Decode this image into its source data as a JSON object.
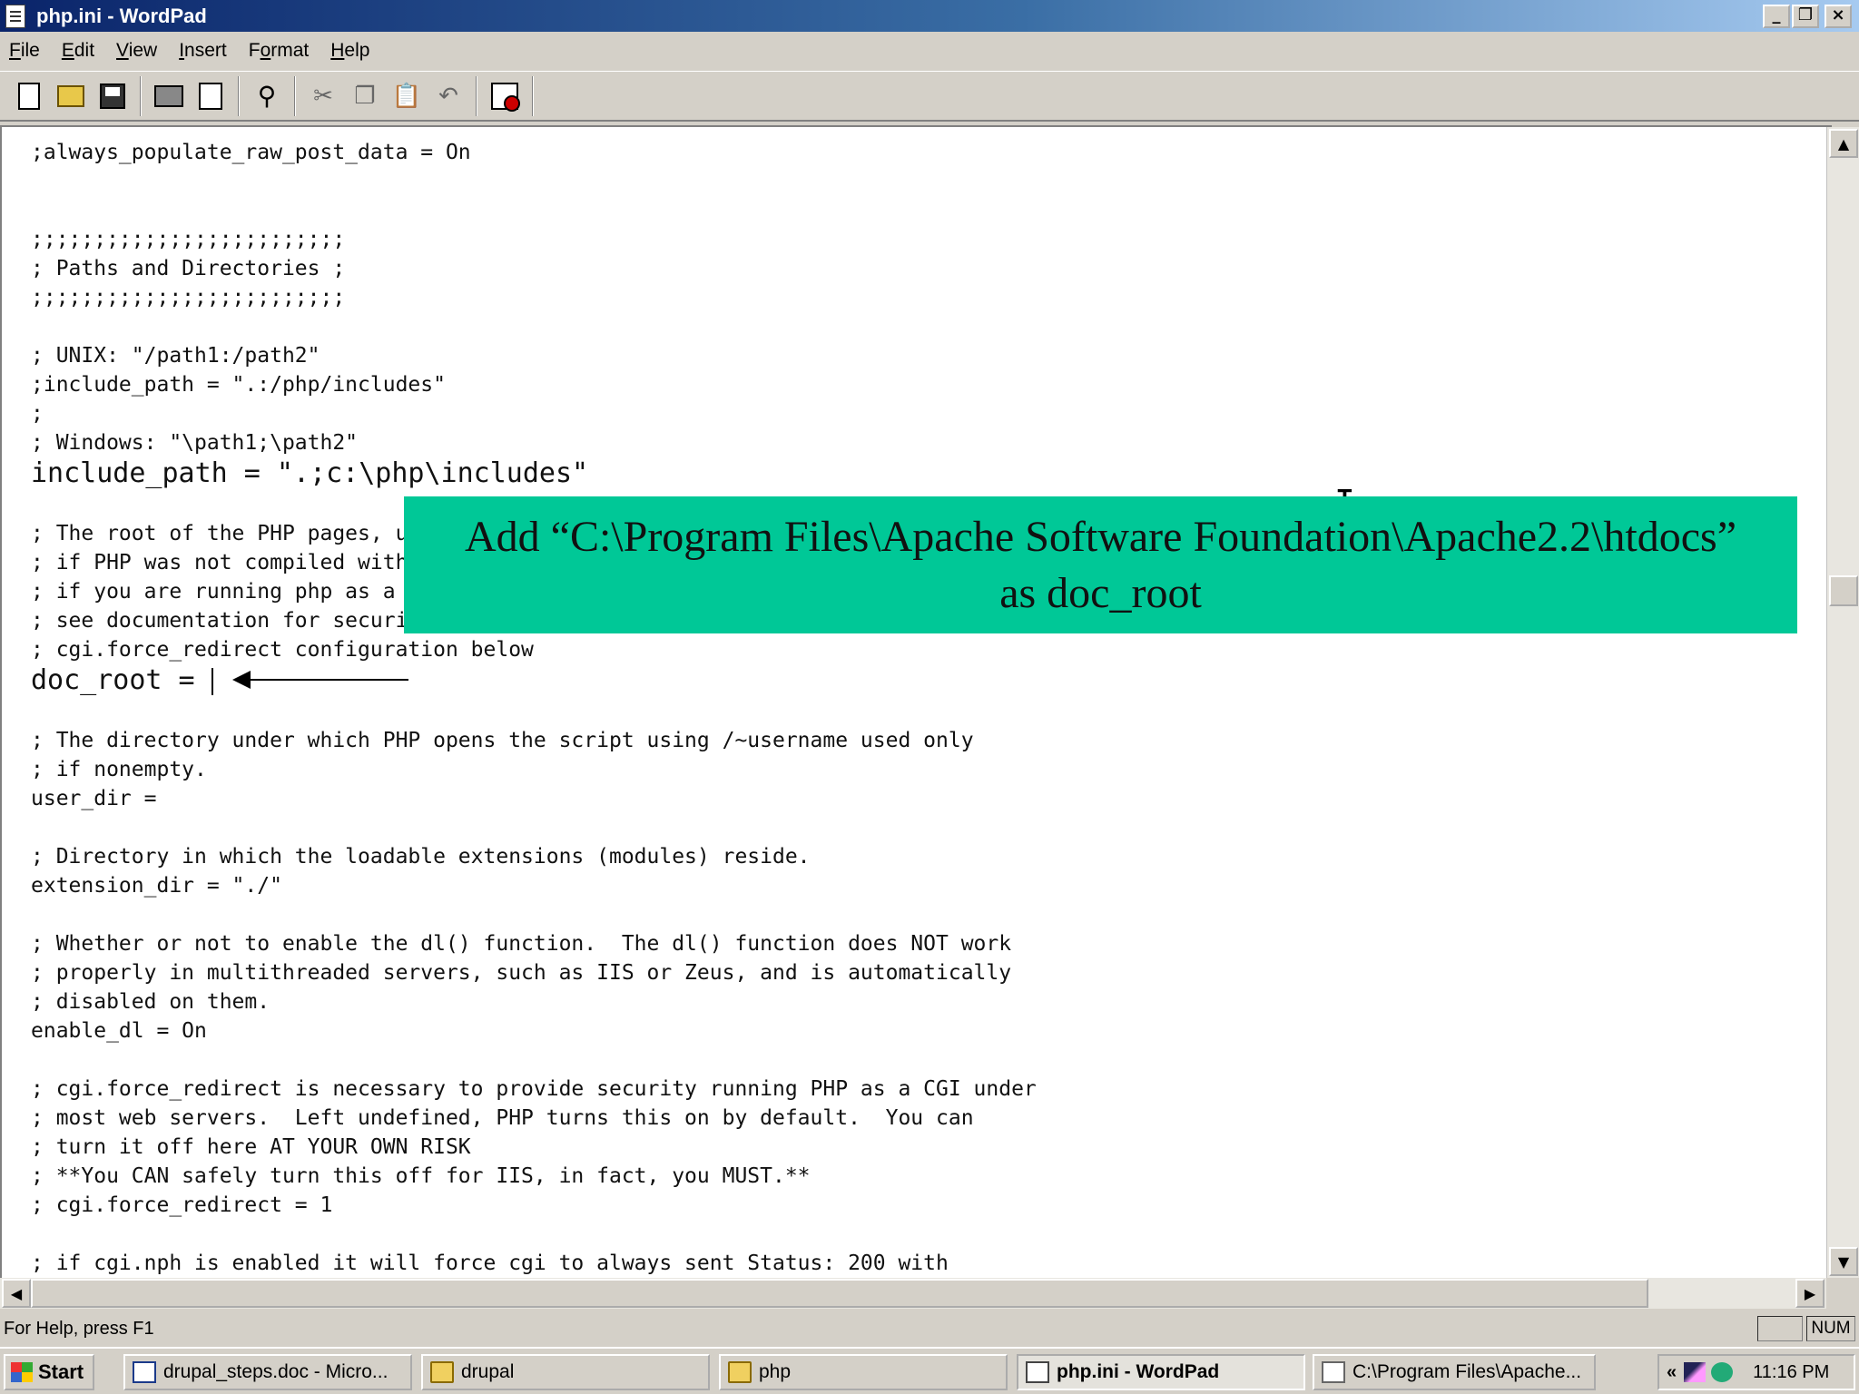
{
  "window": {
    "title": "php.ini - WordPad",
    "controls": {
      "minimize": "_",
      "restore": "❐",
      "close": "×"
    }
  },
  "menu": [
    {
      "label": "File",
      "mnemonic": "F",
      "rest": "ile"
    },
    {
      "label": "Edit",
      "mnemonic": "E",
      "rest": "dit"
    },
    {
      "label": "View",
      "mnemonic": "V",
      "rest": "iew"
    },
    {
      "label": "Insert",
      "mnemonic": "I",
      "rest": "nsert"
    },
    {
      "label": "Format",
      "mnemonic": "o",
      "pre": "F",
      "rest": "rmat"
    },
    {
      "label": "Help",
      "mnemonic": "H",
      "rest": "elp"
    }
  ],
  "toolbar": [
    "new-icon",
    "open-icon",
    "save-icon",
    "print-icon",
    "print-preview-icon",
    "find-icon",
    "cut-icon",
    "copy-icon",
    "paste-icon",
    "undo-icon",
    "date-time-icon"
  ],
  "document": {
    "lines": [
      ";always_populate_raw_post_data = On",
      "",
      "",
      ";;;;;;;;;;;;;;;;;;;;;;;;;",
      "; Paths and Directories ;",
      ";;;;;;;;;;;;;;;;;;;;;;;;;",
      "",
      "; UNIX: \"/path1:/path2\"",
      ";include_path = \".:/php/includes\"",
      ";",
      "; Windows: \"\\path1;\\path2\"",
      "include_path = \".;c:\\php\\includes\"",
      "",
      "; The root of the PHP pages, used only if nonempty.",
      "; if PHP was not compiled with FORCE_REDIRECT, you SHOULD set doc_root",
      "; if you are running php as a CGI under any web server (other than IIS)",
      "; see documentation for security issues.  The alternate is to use the",
      "; cgi.force_redirect configuration below",
      "doc_root = ",
      "",
      "; The directory under which PHP opens the script using /~username used only",
      "; if nonempty.",
      "user_dir =",
      "",
      "; Directory in which the loadable extensions (modules) reside.",
      "extension_dir = \"./\"",
      "",
      "; Whether or not to enable the dl() function.  The dl() function does NOT work",
      "; properly in multithreaded servers, such as IIS or Zeus, and is automatically",
      "; disabled on them.",
      "enable_dl = On",
      "",
      "; cgi.force_redirect is necessary to provide security running PHP as a CGI under",
      "; most web servers.  Left undefined, PHP turns this on by default.  You can",
      "; turn it off here AT YOUR OWN RISK",
      "; **You CAN safely turn this off for IIS, in fact, you MUST.**",
      "; cgi.force_redirect = 1",
      "",
      "; if cgi.nph is enabled it will force cgi to always sent Status: 200 with"
    ]
  },
  "callout": {
    "line1": "Add “C:\\Program Files\\Apache Software Foundation\\Apache2.2\\htdocs”",
    "line2": "as doc_root",
    "color": "#00c897"
  },
  "status": {
    "help": "For Help, press F1",
    "num": "NUM"
  },
  "taskbar": {
    "start": "Start",
    "tasks": [
      {
        "label": "drupal_steps.doc - Micro...",
        "icon": "word"
      },
      {
        "label": "drupal",
        "icon": "folder"
      },
      {
        "label": "php",
        "icon": "folder"
      },
      {
        "label": "php.ini - WordPad",
        "icon": "wordpad",
        "active": true
      },
      {
        "label": "C:\\Program Files\\Apache...",
        "icon": "edit"
      }
    ],
    "tray": {
      "chevron": "«",
      "clock": "11:16 PM"
    }
  }
}
